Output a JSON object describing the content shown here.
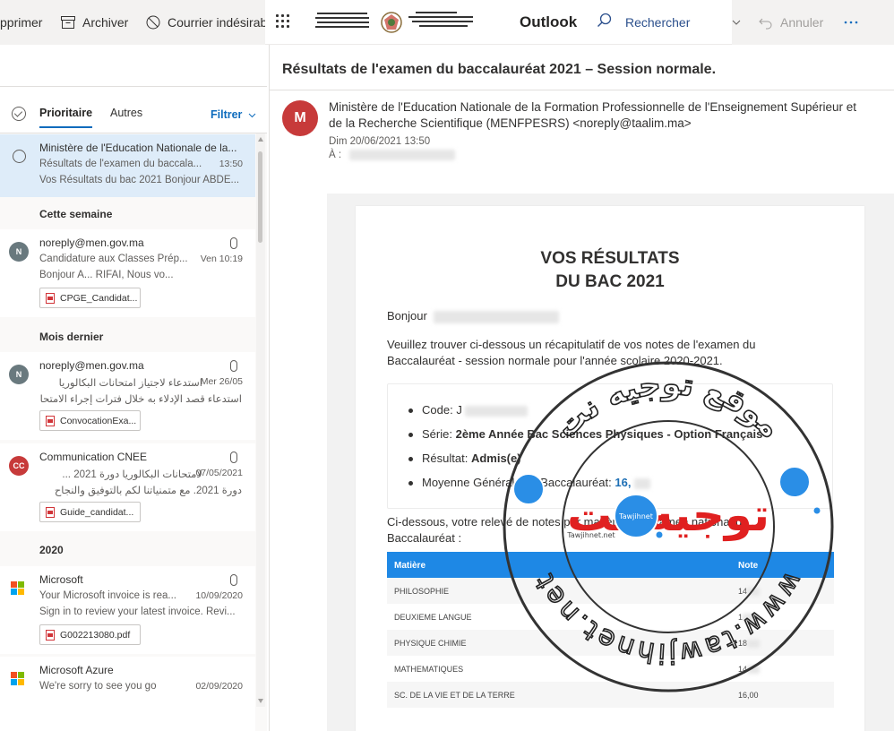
{
  "command_bar": {
    "delete_label": "pprimer",
    "archive_label": "Archiver",
    "junk_label": "Courrier indésirab",
    "undo_label": "Annuler"
  },
  "header": {
    "brand": "Outlook",
    "search_label": "Rechercher"
  },
  "inbox": {
    "tabs": [
      "Prioritaire",
      "Autres"
    ],
    "filter_label": "Filtrer",
    "groups": [
      "Cette semaine",
      "Mois dernier",
      "2020"
    ],
    "messages": [
      {
        "from": "Ministère de l'Education Nationale de la...",
        "subject": "Résultats de l'examen du baccala...",
        "date": "13:50",
        "preview": "Vos Résultats du bac 2021 Bonjour ABDE..."
      },
      {
        "from": "noreply@men.gov.ma",
        "avatar": "N",
        "subject": "Candidature aux Classes Prép...",
        "date": "Ven 10:19",
        "preview": "Bonjour A... RIFAI, Nous vo...",
        "attachment": "CPGE_Candidat..."
      },
      {
        "from": "noreply@men.gov.ma",
        "avatar": "N",
        "subject": "استدعاء لاجتياز امتحانات البكالوريا",
        "date": "Mer 26/05",
        "preview": "استدعاء قصد الإدلاء به خلال فترات إجراء الامتحان",
        "attachment": "ConvocationExa..."
      },
      {
        "from": "Communication CNEE",
        "avatar": "CC",
        "subject": "لامتحانات البكالوريا دورة 2021 ...",
        "date": "07/05/2021",
        "preview": "دورة 2021. مع متمنياتنا لكم بالتوفيق والنجاح",
        "attachment": "Guide_candidat..."
      },
      {
        "from": "Microsoft",
        "subject": "Your Microsoft invoice is rea...",
        "date": "10/09/2020",
        "preview": "Sign in to review your latest invoice. Revi...",
        "attachment": "G002213080.pdf"
      },
      {
        "from": "Microsoft Azure",
        "subject": "We're sorry to see you go",
        "date": "02/09/2020"
      }
    ]
  },
  "reading": {
    "subject": "Résultats de l'examen du baccalauréat 2021 – Session normale.",
    "avatar": "M",
    "sender": "Ministère de l'Education Nationale de la Formation Professionnelle de l'Enseignement Supérieur et de la Recherche Scientifique (MENFPESRS) <noreply@taalim.ma>",
    "date": "Dim 20/06/2021 13:50",
    "to_label": "À :",
    "body": {
      "title_line1": "VOS RÉSULTATS",
      "title_line2": "DU BAC 2021",
      "greeting": "Bonjour",
      "intro": "Veuillez trouver ci-dessous un récapitulatif de vos notes de l'examen du Baccalauréat - session normale pour l'année scolaire 2020-2021.",
      "code_label": "Code:",
      "code_value": "J",
      "serie_label": "Série:",
      "serie_value": "2ème Année Bac Sciences Physiques - Option Français",
      "resultat_label": "Résultat:",
      "resultat_value": "Admis(e)",
      "moyenne_label": "Moyenne Générale du Baccalauréat:",
      "moyenne_value": "16,",
      "releve_intro": "Ci-dessous, votre relevé de notes par matière de l'examen national du Baccalauréat :",
      "table": {
        "headers": [
          "Matière",
          "Note"
        ],
        "rows": [
          [
            "PHILOSOPHIE",
            "14"
          ],
          [
            "DEUXIEME LANGUE",
            "1"
          ],
          [
            "PHYSIQUE CHIMIE",
            "18"
          ],
          [
            "MATHEMATIQUES",
            "14"
          ],
          [
            "SC. DE LA VIE ET DE LA TERRE",
            "16,00"
          ]
        ]
      }
    }
  },
  "watermark": {
    "arabic_top": "موقع توجيه نت",
    "arabic_center": "توجيه نت",
    "url": "www.tawjihnet.net",
    "badge": "Tawjihnet",
    "small": "Tawjihnet.net"
  },
  "colors": {
    "accent": "#0f6cbd",
    "table_header": "#1e88e5",
    "avatar_m": "#c73a3a",
    "avatar_cc": "#c73a3a",
    "avatar_n": "#69797e",
    "selected_row": "#deecf9",
    "watermark_red": "#e02020"
  }
}
